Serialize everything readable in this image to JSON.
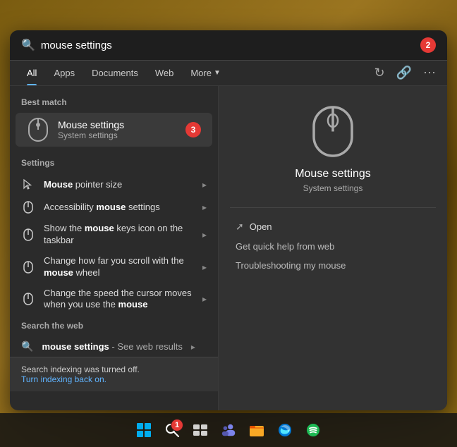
{
  "search": {
    "query": "mouse settings",
    "placeholder": "mouse settings",
    "step_badge": "2"
  },
  "tabs": {
    "items": [
      {
        "label": "All",
        "active": true
      },
      {
        "label": "Apps",
        "active": false
      },
      {
        "label": "Documents",
        "active": false
      },
      {
        "label": "Web",
        "active": false
      },
      {
        "label": "More",
        "active": false
      }
    ],
    "right_icons": [
      "refresh",
      "share",
      "more"
    ]
  },
  "left": {
    "best_match_label": "Best match",
    "best_match": {
      "title": "Mouse settings",
      "subtitle": "System settings",
      "step_badge": "3"
    },
    "settings_label": "Settings",
    "settings_items": [
      {
        "text": "Mouse pointer size",
        "bold_word": "Mouse"
      },
      {
        "text": "Accessibility mouse settings",
        "bold_word": "mouse"
      },
      {
        "text": "Show the mouse keys icon on the taskbar",
        "bold_word": "mouse"
      },
      {
        "text": "Change how far you scroll with the mouse wheel",
        "bold_word": "mouse"
      },
      {
        "text": "Change the speed the cursor moves when you use the mouse",
        "bold_word": "mouse"
      }
    ],
    "web_label": "Search the web",
    "web_item": {
      "query": "mouse settings",
      "suffix": "- See web results"
    },
    "notice": {
      "main": "Search indexing was turned off.",
      "link": "Turn indexing back on."
    }
  },
  "right": {
    "title": "Mouse settings",
    "subtitle": "System settings",
    "open_label": "Open",
    "actions": [
      {
        "label": "Get quick help from web"
      },
      {
        "label": "Troubleshooting my mouse"
      }
    ]
  },
  "taskbar": {
    "icons": [
      {
        "name": "start",
        "label": "Start"
      },
      {
        "name": "search",
        "label": "Search",
        "badge": "1"
      },
      {
        "name": "taskview",
        "label": "Task View"
      },
      {
        "name": "teams",
        "label": "Microsoft Teams"
      },
      {
        "name": "files",
        "label": "File Explorer"
      },
      {
        "name": "edge",
        "label": "Microsoft Edge"
      },
      {
        "name": "spotify",
        "label": "Spotify"
      }
    ]
  }
}
